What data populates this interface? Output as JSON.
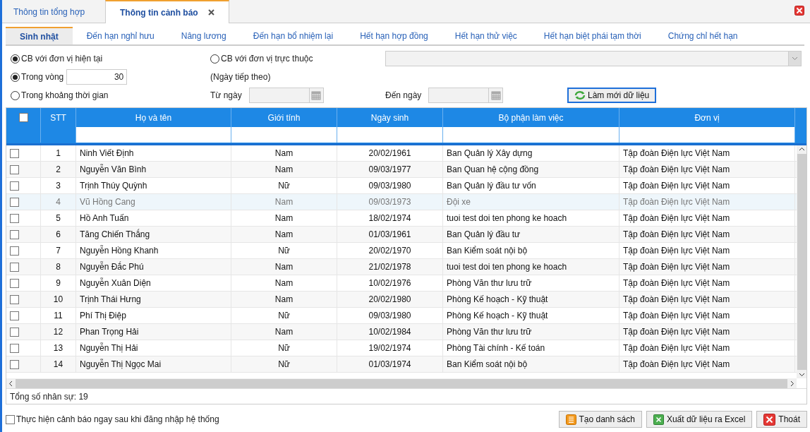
{
  "main_tabs": [
    {
      "label": "Thông tin tổng hợp",
      "selected": false,
      "closable": false
    },
    {
      "label": "Thông tin cảnh báo",
      "selected": true,
      "closable": true
    }
  ],
  "sub_tabs": [
    {
      "label": "Sinh nhật",
      "selected": true
    },
    {
      "label": "Đến hạn nghỉ hưu",
      "selected": false
    },
    {
      "label": "Nâng lương",
      "selected": false
    },
    {
      "label": "Đến hạn bổ nhiệm lại",
      "selected": false
    },
    {
      "label": "Hết hạn hợp đồng",
      "selected": false
    },
    {
      "label": "Hết hạn thử việc",
      "selected": false
    },
    {
      "label": "Hết hạn biệt phái tạm thời",
      "selected": false
    },
    {
      "label": "Chứng chỉ hết hạn",
      "selected": false
    }
  ],
  "scope_options": [
    {
      "label": "CB với đơn vị hiện tại",
      "selected": true
    },
    {
      "label": "CB với đơn vị trực thuộc",
      "selected": false
    }
  ],
  "period_options": [
    {
      "label": "Trong vòng",
      "selected": true
    },
    {
      "label": "Trong khoảng thời gian",
      "selected": false
    }
  ],
  "days_field": {
    "value": "30"
  },
  "days_note": "(Ngày tiếp theo)",
  "from_date": {
    "label": "Từ ngày"
  },
  "to_date": {
    "label": "Đến ngày"
  },
  "refresh_button": "Làm mới dữ liệu",
  "table": {
    "header_checked": false,
    "columns": [
      "STT",
      "Họ và tên",
      "Giới tính",
      "Ngày sinh",
      "Bộ phận làm việc",
      "Đơn vị"
    ],
    "rows": [
      {
        "checked": false,
        "selected": false,
        "cells": [
          "1",
          "Ninh Viết Định",
          "Nam",
          "20/02/1961",
          "Ban Quản lý Xây dựng",
          "Tập đoàn Điện lực Việt Nam"
        ]
      },
      {
        "checked": false,
        "selected": false,
        "cells": [
          "2",
          "Nguyễn Văn Bình",
          "Nam",
          "09/03/1977",
          "Ban Quan hệ cộng đồng",
          "Tập đoàn Điện lực Việt Nam"
        ]
      },
      {
        "checked": false,
        "selected": false,
        "cells": [
          "3",
          "Trịnh Thúy Quỳnh",
          "Nữ",
          "09/03/1980",
          "Ban Quản lý đầu tư vốn",
          "Tập đoàn Điện lực Việt Nam"
        ]
      },
      {
        "checked": false,
        "selected": true,
        "cells": [
          "4",
          "Vũ Hồng Cang",
          "Nam",
          "09/03/1973",
          "Đội xe",
          "Tập đoàn Điện lực Việt Nam"
        ]
      },
      {
        "checked": false,
        "selected": false,
        "cells": [
          "5",
          "Hồ Anh Tuấn",
          "Nam",
          "18/02/1974",
          "tuoi test doi ten phong ke hoach",
          "Tập đoàn Điện lực Việt Nam"
        ]
      },
      {
        "checked": false,
        "selected": false,
        "cells": [
          "6",
          "Tăng Chiến Thắng",
          "Nam",
          "01/03/1961",
          "Ban Quản lý đầu tư",
          "Tập đoàn Điện lực Việt Nam"
        ]
      },
      {
        "checked": false,
        "selected": false,
        "cells": [
          "7",
          "Nguyễn Hồng Khanh",
          "Nữ",
          "20/02/1970",
          "Ban Kiểm soát nội bộ",
          "Tập đoàn Điện lực Việt Nam"
        ]
      },
      {
        "checked": false,
        "selected": false,
        "cells": [
          "8",
          "Nguyễn Đắc Phú",
          "Nam",
          "21/02/1978",
          "tuoi test doi ten phong ke hoach",
          "Tập đoàn Điện lực Việt Nam"
        ]
      },
      {
        "checked": false,
        "selected": false,
        "cells": [
          "9",
          "Nguyễn Xuân Diện",
          "Nam",
          "10/02/1976",
          "Phòng Văn thư lưu trữ",
          "Tập đoàn Điện lực Việt Nam"
        ]
      },
      {
        "checked": false,
        "selected": false,
        "cells": [
          "10",
          "Trịnh Thái Hưng",
          "Nam",
          "20/02/1980",
          "Phòng Kế hoạch - Kỹ thuật",
          "Tập đoàn Điện lực Việt Nam"
        ]
      },
      {
        "checked": false,
        "selected": false,
        "cells": [
          "11",
          "Phí Thị Điệp",
          "Nữ",
          "09/03/1980",
          "Phòng Kế hoạch - Kỹ thuật",
          "Tập đoàn Điện lực Việt Nam"
        ]
      },
      {
        "checked": false,
        "selected": false,
        "cells": [
          "12",
          "Phan Trọng Hải",
          "Nam",
          "10/02/1984",
          "Phòng Văn thư lưu trữ",
          "Tập đoàn Điện lực Việt Nam"
        ]
      },
      {
        "checked": false,
        "selected": false,
        "cells": [
          "13",
          "Nguyễn Thị Hải",
          "Nữ",
          "19/02/1974",
          "Phòng Tài chính - Kế toán",
          "Tập đoàn Điện lực Việt Nam"
        ]
      },
      {
        "checked": false,
        "selected": false,
        "cells": [
          "14",
          "Nguyễn Thị Ngọc Mai",
          "Nữ",
          "01/03/1974",
          "Ban Kiểm soát nội bộ",
          "Tập đoàn Điện lực Việt Nam"
        ]
      }
    ]
  },
  "total": "Tổng số nhân sự: 19",
  "auto_warn": {
    "label": "Thực hiện cảnh báo ngay sau khi đăng nhập hệ thống",
    "checked": false
  },
  "buttons": [
    {
      "label": "Tạo danh sách",
      "kind": "list"
    },
    {
      "label": "Xuất dữ liệu ra Excel",
      "kind": "excel"
    },
    {
      "label": "Thoát",
      "kind": "exit"
    }
  ]
}
